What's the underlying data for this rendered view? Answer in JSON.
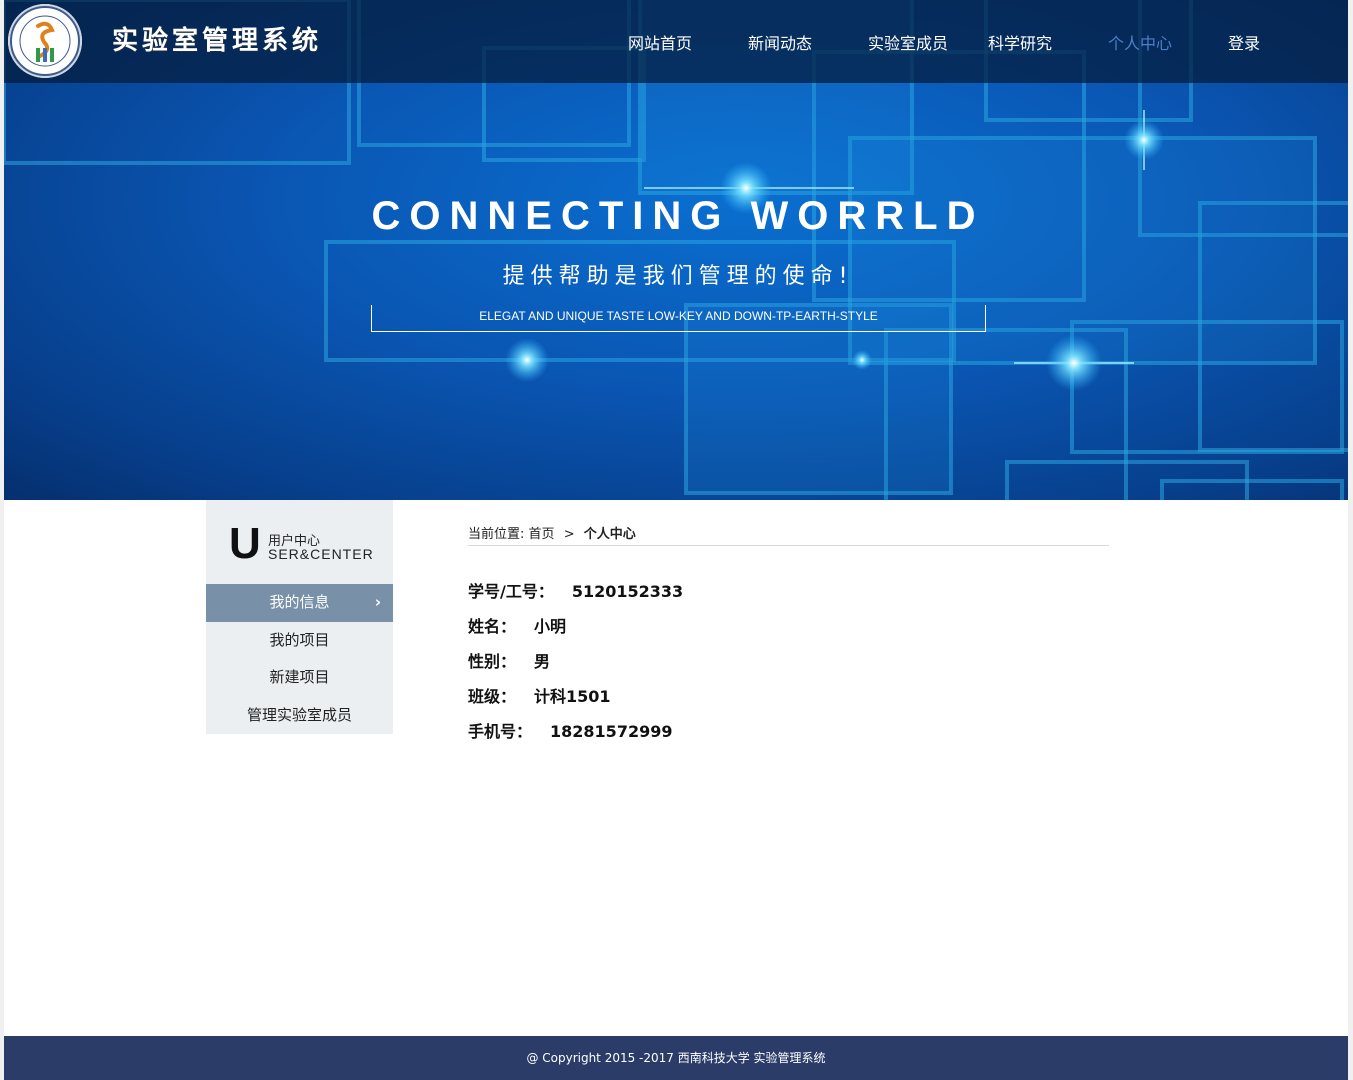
{
  "header": {
    "site_title": "实验室管理系统",
    "nav": [
      {
        "label": "网站首页",
        "active": false
      },
      {
        "label": "新闻动态",
        "active": false
      },
      {
        "label": "实验室成员",
        "active": false
      },
      {
        "label": "科学研究",
        "active": false
      },
      {
        "label": "个人中心",
        "active": true
      },
      {
        "label": "登录",
        "active": false
      }
    ]
  },
  "hero": {
    "title": "CONNECTING WORRLD",
    "subtitle": "提供帮助是我们管理的使命!",
    "tagline": "ELEGAT AND UNIQUE TASTE LOW-KEY AND DOWN-TP-EARTH-STYLE"
  },
  "sidebar": {
    "big_letter": "U",
    "heading_cn": "用户中心",
    "heading_en": "SER&CENTER",
    "items": [
      {
        "label": "我的信息",
        "active": true
      },
      {
        "label": "我的项目",
        "active": false
      },
      {
        "label": "新建项目",
        "active": false
      },
      {
        "label": "管理实验室成员",
        "active": false
      }
    ],
    "active_chevron": "›"
  },
  "breadcrumb": {
    "prefix": "当前位置:",
    "home": "首页",
    "separator": ">",
    "current": "个人中心"
  },
  "profile": [
    {
      "label": "学号/工号：",
      "value": "5120152333"
    },
    {
      "label": "姓名：",
      "value": "小明"
    },
    {
      "label": "性别：",
      "value": "男"
    },
    {
      "label": "班级：",
      "value": "计科1501"
    },
    {
      "label": "手机号：",
      "value": "18281572999"
    }
  ],
  "footer": {
    "copyright": "@ Copyright 2015 -2017 西南科技大学 实验管理系统"
  },
  "colors": {
    "header_bg": "#041c3c",
    "nav_active": "#4e7fc5",
    "sidebar_bg": "#eceff2",
    "sidebar_active": "#7890a8",
    "footer_bg": "#2b3c68"
  },
  "icons": {
    "logo": "university-seal-icon",
    "chevron": "chevron-right-icon"
  }
}
